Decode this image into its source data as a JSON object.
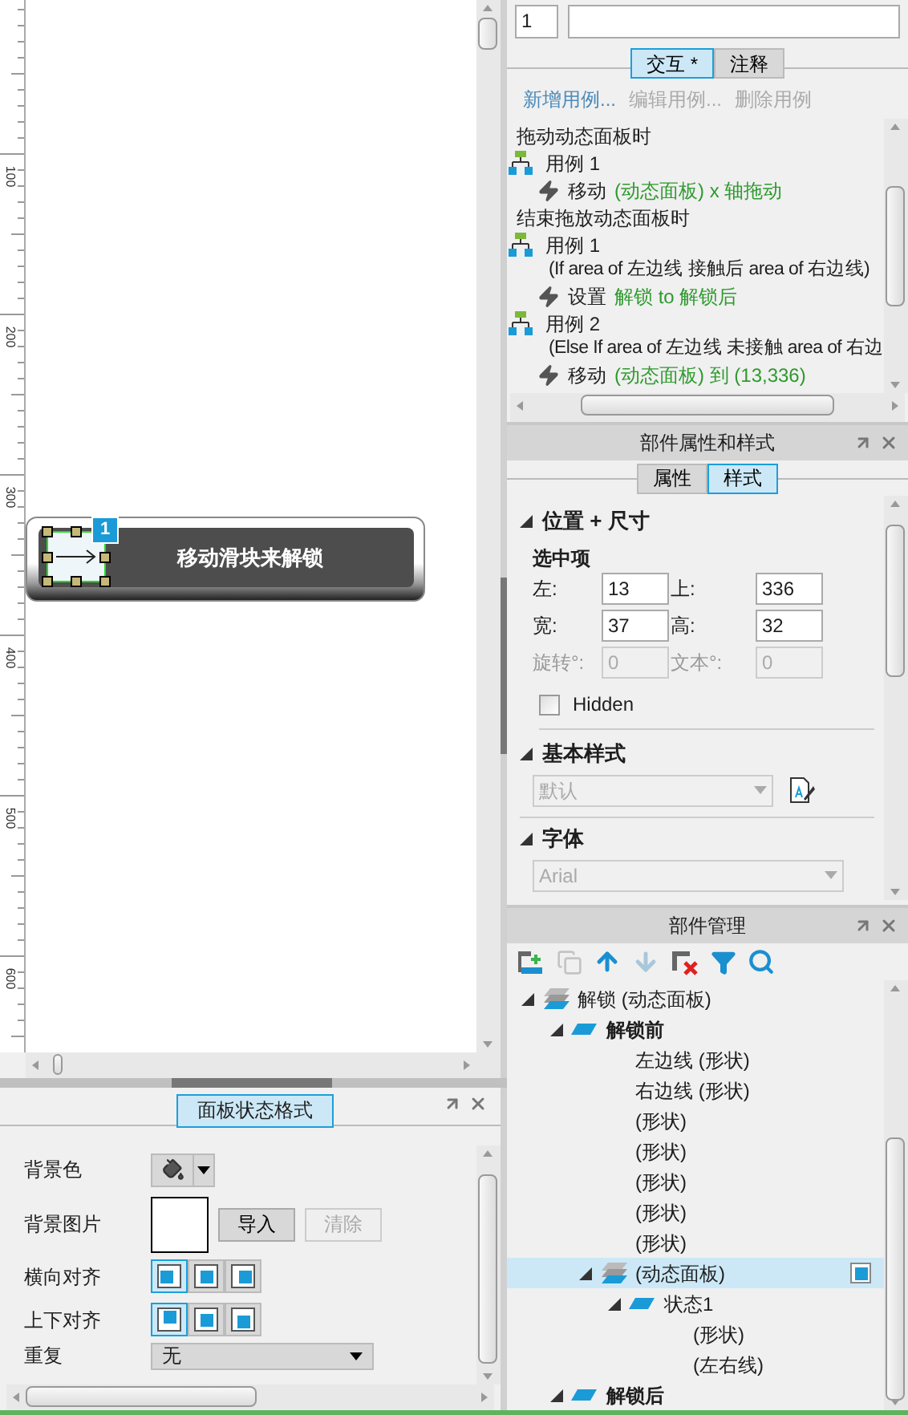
{
  "canvas": {
    "ruler_labels": [
      "100",
      "200",
      "300",
      "400",
      "500",
      "600"
    ],
    "slider": {
      "label": "移动滑块来解锁",
      "badge": "1",
      "handle_selected": true
    }
  },
  "state_format_panel": {
    "title": "面板状态格式",
    "rows": [
      {
        "kind": "color",
        "label": "背景色"
      },
      {
        "kind": "image",
        "label": "背景图片",
        "buttons": [
          {
            "label": "导入",
            "disabled": false
          },
          {
            "label": "清除",
            "disabled": true
          }
        ]
      },
      {
        "kind": "align",
        "label": "横向对齐",
        "options": [
          {
            "kind": "left",
            "selected": true
          },
          {
            "kind": "center",
            "selected": false
          },
          {
            "kind": "right",
            "selected": false
          }
        ]
      },
      {
        "kind": "align",
        "label": "上下对齐",
        "options": [
          {
            "kind": "top",
            "selected": true
          },
          {
            "kind": "middle",
            "selected": false
          },
          {
            "kind": "bottom",
            "selected": false
          }
        ]
      },
      {
        "kind": "select",
        "label": "重复",
        "value": "无"
      }
    ]
  },
  "interaction_panel": {
    "case_number": "1",
    "tabs": [
      {
        "label": "交互 *",
        "selected": true
      },
      {
        "label": "注释",
        "selected": false
      }
    ],
    "actions": [
      {
        "label": "新增用例...",
        "disabled": false
      },
      {
        "label": "编辑用例...",
        "disabled": true
      },
      {
        "label": "删除用例",
        "disabled": true
      }
    ],
    "tree": [
      {
        "kind": "event",
        "text": "拖动动态面板时"
      },
      {
        "kind": "case",
        "text": "用例 1"
      },
      {
        "kind": "action",
        "verb": "移动",
        "target": "(动态面板) x 轴拖动"
      },
      {
        "kind": "event",
        "text": "结束拖放动态面板时"
      },
      {
        "kind": "case",
        "text": "用例 1"
      },
      {
        "kind": "condition",
        "text": "(If area of 左边线 接触后 area of 右边线)"
      },
      {
        "kind": "action",
        "verb": "设置",
        "target": "解锁 to 解锁后"
      },
      {
        "kind": "case",
        "text": "用例 2"
      },
      {
        "kind": "condition",
        "text": "(Else If area of 左边线 未接触 area of 右边"
      },
      {
        "kind": "action",
        "verb": "移动",
        "target": "(动态面板) 到 (13,336)"
      }
    ]
  },
  "style_panel": {
    "title": "部件属性和样式",
    "tabs": [
      {
        "label": "属性",
        "selected": false
      },
      {
        "label": "样式",
        "selected": true
      }
    ],
    "position_section": {
      "title": "位置 + 尺寸",
      "subtitle": "选中项",
      "fields": [
        {
          "label": "左:",
          "value": "13",
          "disabled": false
        },
        {
          "label": "上:",
          "value": "336",
          "disabled": false
        },
        {
          "label": "宽:",
          "value": "37",
          "disabled": false
        },
        {
          "label": "高:",
          "value": "32",
          "disabled": false
        },
        {
          "label": "旋转°:",
          "value": "0",
          "disabled": true
        },
        {
          "label": "文本°:",
          "value": "0",
          "disabled": true
        }
      ],
      "hidden": {
        "label": "Hidden",
        "checked": false
      }
    },
    "base_style_section": {
      "title": "基本样式",
      "value": "默认",
      "disabled": true
    },
    "font_section": {
      "title": "字体",
      "value": "Arial",
      "disabled": true
    }
  },
  "widget_manager": {
    "title": "部件管理",
    "toolbar": [
      {
        "kind": "add",
        "disabled": false
      },
      {
        "kind": "copy",
        "disabled": true
      },
      {
        "kind": "up",
        "disabled": false
      },
      {
        "kind": "down",
        "disabled": true
      },
      {
        "kind": "delete",
        "disabled": false
      },
      {
        "kind": "filter",
        "disabled": false
      },
      {
        "kind": "search",
        "disabled": false
      }
    ],
    "tree": [
      {
        "label": "解锁 (动态面板)",
        "kind": "panel",
        "expanded": true,
        "selected": false,
        "bold": false,
        "children": [
          {
            "label": "解锁前",
            "kind": "state",
            "expanded": true,
            "selected": false,
            "bold": true,
            "children": [
              {
                "label": "左边线 (形状)",
                "kind": "shape",
                "selected": false,
                "bold": false
              },
              {
                "label": "右边线 (形状)",
                "kind": "shape",
                "selected": false,
                "bold": false
              },
              {
                "label": "(形状)",
                "kind": "shape",
                "selected": false,
                "bold": false
              },
              {
                "label": "(形状)",
                "kind": "shape",
                "selected": false,
                "bold": false
              },
              {
                "label": "(形状)",
                "kind": "shape",
                "selected": false,
                "bold": false
              },
              {
                "label": "(形状)",
                "kind": "shape",
                "selected": false,
                "bold": false
              },
              {
                "label": "(形状)",
                "kind": "shape",
                "selected": false,
                "bold": false
              },
              {
                "label": "(动态面板)",
                "kind": "panel",
                "expanded": true,
                "selected": true,
                "bold": false,
                "children": [
                  {
                    "label": "状态1",
                    "kind": "state",
                    "expanded": true,
                    "selected": false,
                    "bold": false,
                    "children": [
                      {
                        "label": "(形状)",
                        "kind": "shape",
                        "selected": false,
                        "bold": false
                      },
                      {
                        "label": "(左右线)",
                        "kind": "shape",
                        "selected": false,
                        "bold": false
                      }
                    ]
                  }
                ]
              }
            ]
          },
          {
            "label": "解锁后",
            "kind": "state",
            "expanded": true,
            "selected": false,
            "bold": true
          }
        ]
      }
    ]
  }
}
